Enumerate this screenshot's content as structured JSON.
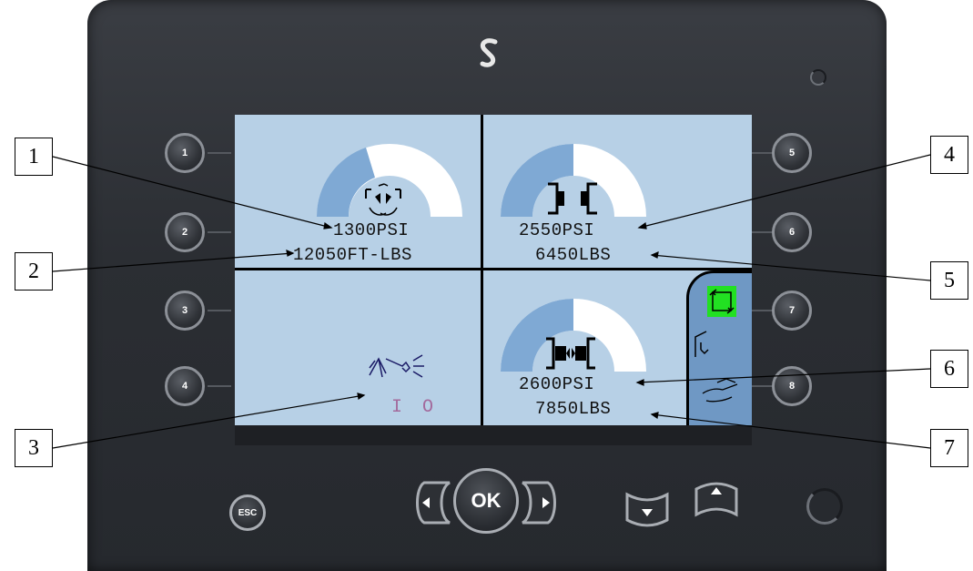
{
  "brand_logo": "S-logo-icon",
  "side_buttons": {
    "left": [
      "1",
      "2",
      "3",
      "4"
    ],
    "right": [
      "5",
      "6",
      "7",
      "8"
    ]
  },
  "quadrants": {
    "q1": {
      "icon": "rotator-icon",
      "pressure": "1300PSI",
      "secondary": "12050FT-LBS"
    },
    "q2": {
      "icon": "clamp-icon",
      "pressure": "2550PSI",
      "secondary": "6450LBS"
    },
    "q3": {
      "icon": "spray-nozzle-icon",
      "state_on": "I",
      "state_off": "O"
    },
    "q4": {
      "icon": "clamp-closed-icon",
      "pressure": "2600PSI",
      "secondary": "7850LBS"
    }
  },
  "mode_panel": {
    "icons": [
      "auto-cycle-icon",
      "lift-icon",
      "hand-icon"
    ],
    "active_color": "#22e022"
  },
  "controls": {
    "esc_label": "ESC",
    "ok_label": "OK",
    "left_arrow": "◀",
    "right_arrow": "▶",
    "down_arrow": "▼",
    "up_arrow": "▲"
  },
  "callouts": [
    "1",
    "2",
    "3",
    "4",
    "5",
    "6",
    "7"
  ],
  "colors": {
    "screen": "#b7d0e6",
    "gauge_fill": "#7fa9d4",
    "gauge_empty": "#ffffff",
    "bezel": "#2b2e33"
  }
}
